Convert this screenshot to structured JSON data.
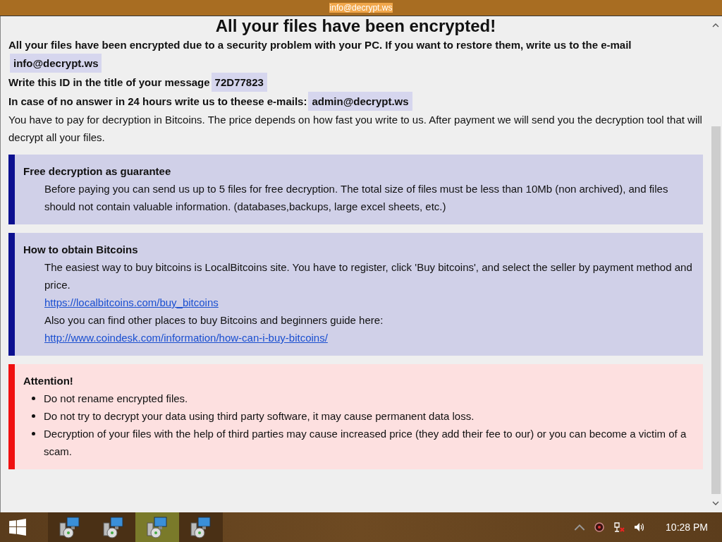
{
  "window": {
    "title": "info@decrypt.ws"
  },
  "heading": "All your files have been encrypted!",
  "intro": [
    {
      "kind": "contact",
      "text": "All your files have been encrypted due to a security problem with your PC. If you want to restore them, write us to the e-mail",
      "value": "info@decrypt.ws"
    },
    {
      "kind": "contact",
      "text": "Write this ID in the title of your message",
      "value": "72D77823"
    },
    {
      "kind": "contact",
      "text": "In case of no answer in 24 hours write us to theese e-mails:",
      "value": "admin@decrypt.ws"
    },
    {
      "kind": "plain",
      "text": "You have to pay for decryption in Bitcoins. The price depends on how fast you write to us. After payment we will send you the decryption tool that will decrypt all your files."
    }
  ],
  "sections": [
    {
      "kind": "info",
      "title": "Free decryption as guarantee",
      "items": [
        {
          "kind": "text",
          "text": "Before paying you can send us up to 5 files for free decryption. The total size of files must be less than 10Mb (non archived), and files should not contain valuable information. (databases,backups, large excel sheets, etc.)"
        }
      ]
    },
    {
      "kind": "info",
      "title": "How to obtain Bitcoins",
      "items": [
        {
          "kind": "text",
          "text": "The easiest way to buy bitcoins is LocalBitcoins site. You have to register, click 'Buy bitcoins', and select the seller by payment method and price."
        },
        {
          "kind": "link",
          "text": "https://localbitcoins.com/buy_bitcoins"
        },
        {
          "kind": "text",
          "text": "Also you can find other places to buy Bitcoins and beginners guide here:"
        },
        {
          "kind": "link",
          "text": "http://www.coindesk.com/information/how-can-i-buy-bitcoins/"
        }
      ]
    },
    {
      "kind": "warning",
      "title": "Attention!",
      "items": [
        {
          "kind": "bullet",
          "text": "Do not rename encrypted files."
        },
        {
          "kind": "bullet",
          "text": "Do not try to decrypt your data using third party software, it may cause permanent data loss."
        },
        {
          "kind": "bullet",
          "text": "Decryption of your files with the help of third parties may cause increased price (they add their fee to our) or you can become a victim of a scam."
        }
      ]
    }
  ],
  "taskbar": {
    "apps": [
      {
        "selected": false
      },
      {
        "selected": false
      },
      {
        "selected": true
      },
      {
        "selected": false
      }
    ],
    "clock": "10:28 PM"
  }
}
